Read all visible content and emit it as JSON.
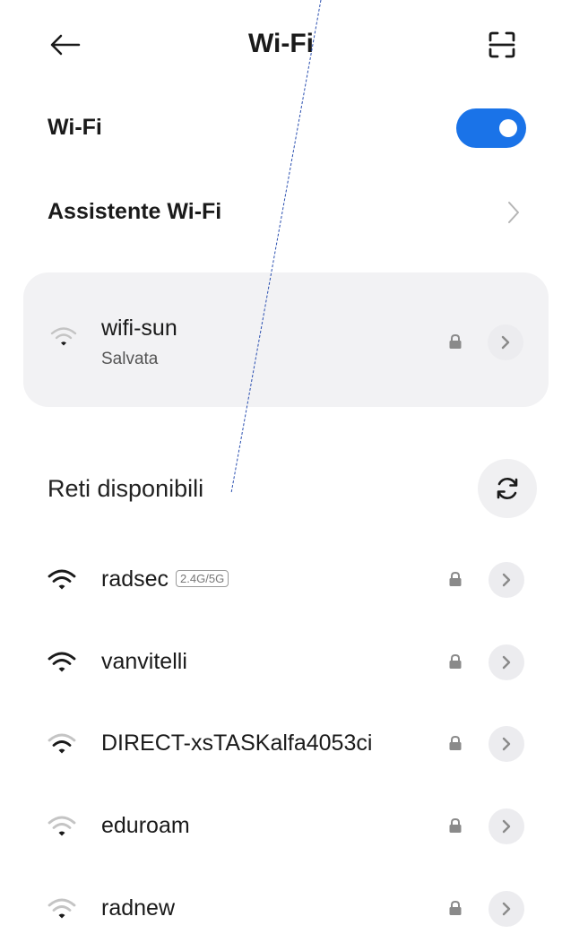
{
  "header": {
    "title": "Wi-Fi",
    "back_icon": "arrow-left-icon",
    "scan_icon": "qr-scan-icon"
  },
  "wifi_toggle": {
    "label": "Wi-Fi",
    "enabled": true,
    "color": "#1a73e8"
  },
  "assistant": {
    "label": "Assistente Wi-Fi"
  },
  "saved_network": {
    "ssid": "wifi-sun",
    "status": "Salvata"
  },
  "available": {
    "title": "Reti disponibili",
    "networks": [
      {
        "ssid": "radsec",
        "badge": "2.4G/5G",
        "signal": "full"
      },
      {
        "ssid": "vanvitelli",
        "badge": "",
        "signal": "full"
      },
      {
        "ssid": "DIRECT-xsTASKalfa4053ci",
        "badge": "",
        "signal": "medium"
      },
      {
        "ssid": "eduroam",
        "badge": "",
        "signal": "weak"
      },
      {
        "ssid": "radnew",
        "badge": "",
        "signal": "weak"
      }
    ]
  }
}
